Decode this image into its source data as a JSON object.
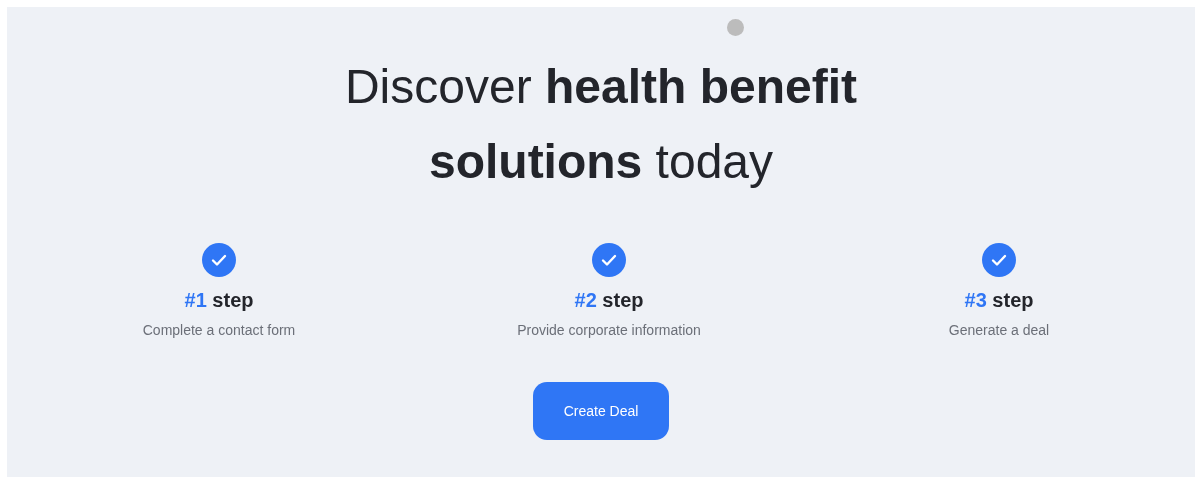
{
  "headline": "Discover **health benefit solutions** today",
  "steps": [
    {
      "number": "#1",
      "word": "step",
      "description": "Complete a contact form"
    },
    {
      "number": "#2",
      "word": "step",
      "description": "Provide corporate information"
    },
    {
      "number": "#3",
      "word": "step",
      "description": "Generate a deal"
    }
  ],
  "button": {
    "label": "Create Deal"
  }
}
